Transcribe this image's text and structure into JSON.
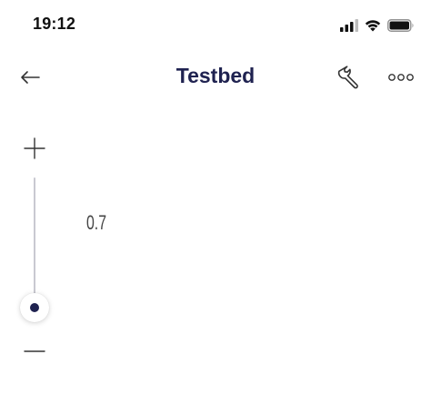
{
  "status_bar": {
    "time": "19:12",
    "icons": [
      "cellular-signal-icon",
      "wifi-icon",
      "battery-icon"
    ]
  },
  "nav": {
    "back_icon": "arrow-left-icon",
    "title": "Testbed",
    "wrench_icon": "wrench-icon",
    "more_icon": "more-horizontal-icon"
  },
  "slider": {
    "increase_icon": "plus-icon",
    "decrease_icon": "minus-icon",
    "value": 0.7,
    "value_label": "0.7",
    "orientation": "vertical"
  },
  "colors": {
    "title": "#1f2250",
    "thumb_dot": "#1f2250",
    "track": "#c9c9d1",
    "background": "#ffffff"
  }
}
